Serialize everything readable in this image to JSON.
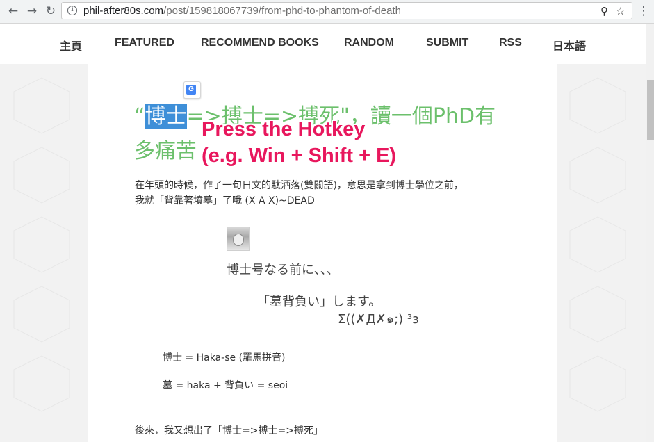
{
  "browser": {
    "back_icon": "←",
    "forward_icon": "→",
    "reload_icon": "↻",
    "info_icon": "i",
    "url_host": "phil-after80s.com",
    "url_path": "/post/159818067739/from-phd-to-phantom-of-death",
    "key_icon": "⚲",
    "star_icon": "☆",
    "menu_icon": "⋮"
  },
  "nav": {
    "items": [
      {
        "label": "主頁"
      },
      {
        "label": "FEATURED"
      },
      {
        "label": "RECOMMEND BOOKS"
      },
      {
        "label": "RANDOM"
      },
      {
        "label": "SUBMIT"
      },
      {
        "label": "RSS"
      },
      {
        "label": "日本語"
      }
    ]
  },
  "post": {
    "title_open_quote": "“",
    "title_selected": "博士",
    "title_rest_line1": "=>搏士=>搏死\"，讀一個PhD有",
    "title_line2": "多痛苦",
    "overlay_line1": "Press the Hotkey",
    "overlay_line2": "(e.g. Win + Shift + E)",
    "translate_icon": "G",
    "para1_line1": "在年頭的時候，作了一句日文的駄洒落(雙關語)，意思是拿到博士學位之前，",
    "para1_line2": "我就「背靠著墳墓」了哦 (X A X)~DEAD",
    "image_line1": "博士号なる前に、、、",
    "image_line2": "「墓背負い」します。",
    "image_line3": "Σ((✗Д✗๑;) ³з",
    "def1": "博士 = Haka-se (羅馬拼音)",
    "def2": "墓 = haka + 背負い = seoi",
    "para2": "後來，我又想出了「博士=>搏士=>搏死」"
  },
  "colors": {
    "title_green": "#6cc06c",
    "selection_blue": "#3e8fd8",
    "overlay_pink": "#e8175d"
  }
}
